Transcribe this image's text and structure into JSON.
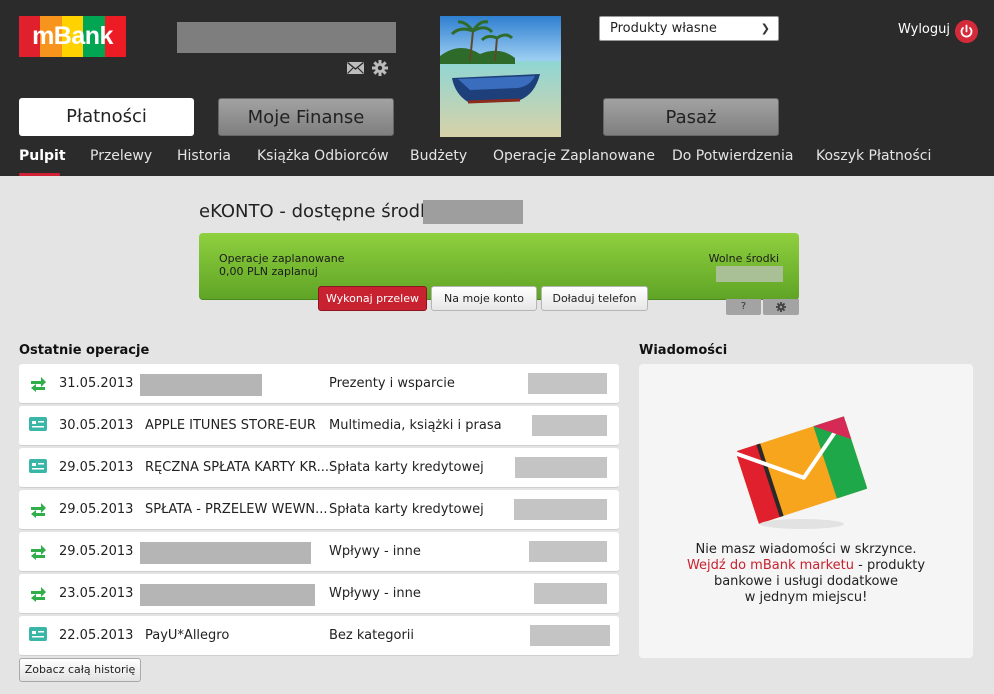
{
  "brand": {
    "logo_text": "mBank",
    "colors": [
      "#e0202c",
      "#f7941d",
      "#ffd200",
      "#00a651",
      "#ed1c24"
    ]
  },
  "header": {
    "product_select": {
      "value": "Produkty własne"
    },
    "logout_label": "Wyloguj",
    "main_tabs": [
      {
        "label": "Płatności",
        "active": true
      },
      {
        "label": "Moje Finanse",
        "active": false
      },
      {
        "label": "Pasaż",
        "active": false
      }
    ],
    "subnav": [
      {
        "label": "Pulpit",
        "active": true
      },
      {
        "label": "Przelewy"
      },
      {
        "label": "Historia"
      },
      {
        "label": "Książka Odbiorców"
      },
      {
        "label": "Budżety"
      },
      {
        "label": "Operacje Zaplanowane"
      },
      {
        "label": "Do Potwierdzenia"
      },
      {
        "label": "Koszyk Płatności"
      }
    ],
    "icons": [
      "envelope-icon",
      "gear-icon",
      "power-icon",
      "chevron-down-icon"
    ]
  },
  "account": {
    "title": "eKONTO - dostępne środki",
    "planned_label": "Operacje zaplanowane",
    "planned_value": "0,00 PLN zaplanuj",
    "free_funds_label": "Wolne środki",
    "buttons": {
      "transfer": "Wykonaj przelew",
      "own_account": "Na moje konto",
      "topup": "Doładuj telefon",
      "help": "?"
    },
    "accent_color": "#c8212f",
    "panel_color": "#78bb31"
  },
  "operations": {
    "heading": "Ostatnie operacje",
    "rows": [
      {
        "type": "transfer",
        "date": "31.05.2013",
        "description": "",
        "category": "Prezenty i wsparcie"
      },
      {
        "type": "card",
        "date": "30.05.2013",
        "description": "APPLE ITUNES STORE-EUR",
        "category": "Multimedia, książki i prasa"
      },
      {
        "type": "card",
        "date": "29.05.2013",
        "description": "RĘCZNA SPŁATA KARTY KR...",
        "category": "Spłata karty kredytowej"
      },
      {
        "type": "transfer",
        "date": "29.05.2013",
        "description": "SPŁATA - PRZELEW WEWN...",
        "category": "Spłata karty kredytowej"
      },
      {
        "type": "transfer",
        "date": "29.05.2013",
        "description": "",
        "category": "Wpływy - inne"
      },
      {
        "type": "transfer",
        "date": "23.05.2013",
        "description": "",
        "category": "Wpływy - inne"
      },
      {
        "type": "card",
        "date": "22.05.2013",
        "description": "PayU*Allegro",
        "category": "Bez kategorii"
      }
    ],
    "history_button": "Zobacz całą historię"
  },
  "messages": {
    "heading": "Wiadomości",
    "line1": "Nie masz wiadomości w skrzynce.",
    "link": "Wejdź do mBank marketu",
    "line2_rest": " - produkty",
    "line3": "bankowe i usługi dodatkowe",
    "line4": "w jednym miejscu!"
  }
}
